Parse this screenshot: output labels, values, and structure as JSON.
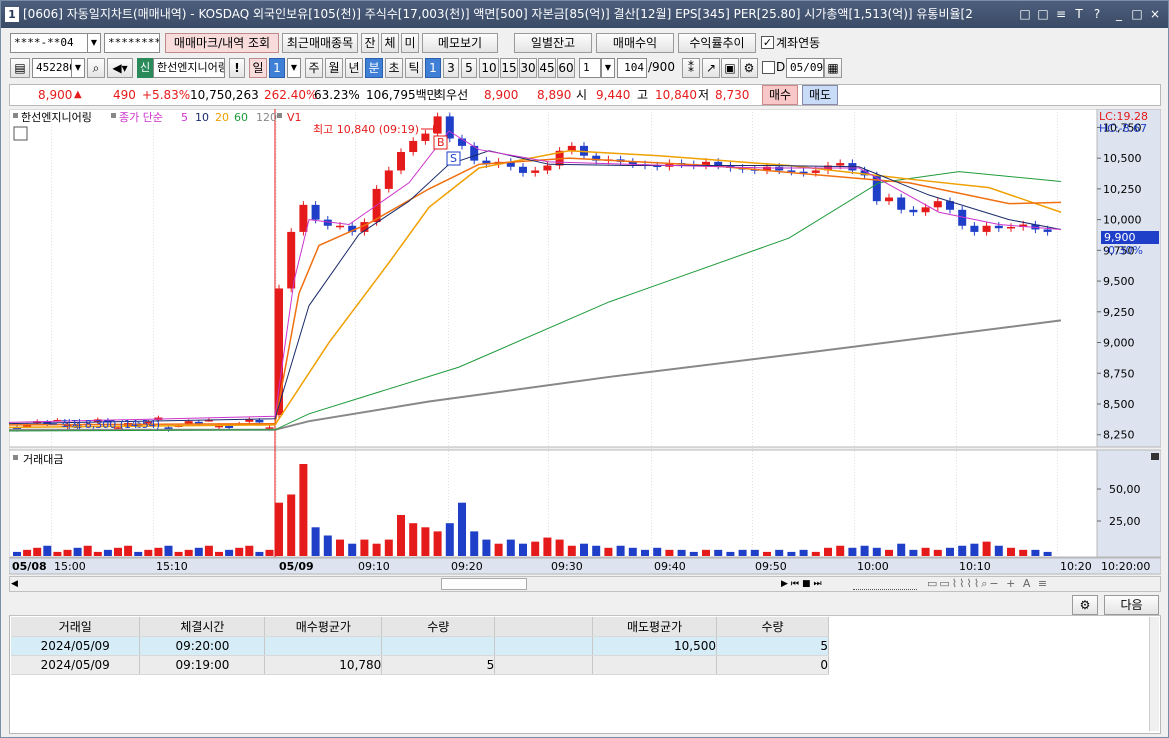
{
  "window": {
    "title": "[0606] 자동일지차트(매매내역) - KOSDAQ 외국인보유[105(천)] 주식수[17,003(천)] 액면[500] 자본금[85(억)] 결산[12월] EPS[345] PER[25.80] 시가총액[1,513(억)] 유통비율[2",
    "icon_label": "1",
    "controls": [
      "□",
      "□",
      "≡",
      "T",
      "?",
      "_",
      "□",
      "×"
    ]
  },
  "toolbar1": {
    "account": "****-**04",
    "password": "********",
    "buttons": [
      "매매마크/내역 조회",
      "최근매매종목",
      "잔",
      "체",
      "미",
      "메모보기",
      "일별잔고",
      "매매수익",
      "수익률추이"
    ],
    "account_link_label": "계좌연동",
    "account_link_checked": true
  },
  "toolbar2": {
    "stock_code": "452280",
    "stock_badge": "신",
    "stock_name": "한선엔지니어링",
    "bang": "!",
    "period_buttons": [
      "일",
      "1",
      "주",
      "월",
      "년",
      "분",
      "초",
      "틱"
    ],
    "interval_buttons": [
      "1",
      "3",
      "5",
      "10",
      "15",
      "30",
      "45",
      "60"
    ],
    "interval_value": "1",
    "count_value": "104",
    "count_total": "/900",
    "d_label": "D",
    "date_value": "05/09"
  },
  "quote": {
    "price": "8,900",
    "up_mark": "▲",
    "change": "490",
    "change_pct": "+5.83%",
    "volume": "10,750,263",
    "vol_ratio": "262.40%",
    "turnover": "63.23%",
    "amount": "106,795백만",
    "best_label": "최우선",
    "best_ask": "8,900",
    "best_bid": "8,890",
    "open_label": "시",
    "open": "9,440",
    "high_label": "고",
    "high": "10,840",
    "low_label": "저",
    "low": "8,730",
    "buy_label": "매수",
    "sell_label": "매도"
  },
  "chart": {
    "legend_stock": "한선엔지니어링",
    "legend_ma_label": "종가 단순",
    "legend_ma": [
      "5",
      "10",
      "20",
      "60",
      "120"
    ],
    "legend_v": "V1",
    "max_annotation": "최고 10,840 (09:19)",
    "min_annotation": "최저 8,300 (14:54)",
    "lc_label": "LC:19.28",
    "hc_label": "HC:-8.67",
    "current_price_tag": "9,900",
    "current_change_tag": "-0.30%",
    "price_axis": [
      "10,750",
      "10,500",
      "10,250",
      "10,000",
      "9,750",
      "9,500",
      "9,250",
      "9,000",
      "8,750",
      "8,500",
      "8,250"
    ],
    "volume_title": "거래대금",
    "volume_axis": [
      "50,00",
      "25,00"
    ],
    "time_axis": [
      "05/08",
      "15:00",
      "15:10",
      "05/09",
      "09:10",
      "09:20",
      "09:30",
      "09:40",
      "09:50",
      "10:00",
      "10:10",
      "10:20"
    ],
    "time_readout": "10:20:00",
    "buy_marker": "B",
    "sell_marker": "S",
    "colors": {
      "up": "#e51a1a",
      "down": "#1f3fc8",
      "ma5": "#cc33cc",
      "ma10": "#1a2a6a",
      "ma20": "#f0a000",
      "ma60": "#1e9a3a",
      "ma120": "#888888",
      "orange": "#f07010"
    }
  },
  "chart_data": {
    "type": "candlestick",
    "title": "",
    "xlabel": "",
    "ylabel": "",
    "ylim": [
      8150,
      10900
    ],
    "x": [
      "05/08 14:54",
      "05/08 15:00",
      "05/08 15:10",
      "05/09 09:00",
      "05/09 09:10",
      "05/09 09:19",
      "05/09 09:20",
      "05/09 09:30",
      "05/09 09:40",
      "05/09 09:50",
      "05/09 10:00",
      "05/09 10:10",
      "05/09 10:20"
    ],
    "series": [
      {
        "name": "",
        "values": [
          8300,
          8350,
          8380,
          9440,
          9900,
          10840,
          10560,
          10480,
          10420,
          10380,
          10420,
          9950,
          9900
        ]
      }
    ]
  },
  "bottom": {
    "next_label": "다음",
    "columns": [
      "거래일",
      "체결시간",
      "매수평균가",
      "수량",
      "",
      "매도평균가",
      "수량"
    ],
    "rows": [
      [
        "2024/05/09",
        "09:20:00",
        "",
        "",
        "",
        "10,500",
        "5"
      ],
      [
        "2024/05/09",
        "09:19:00",
        "10,780",
        "5",
        "",
        "",
        "0"
      ]
    ]
  }
}
